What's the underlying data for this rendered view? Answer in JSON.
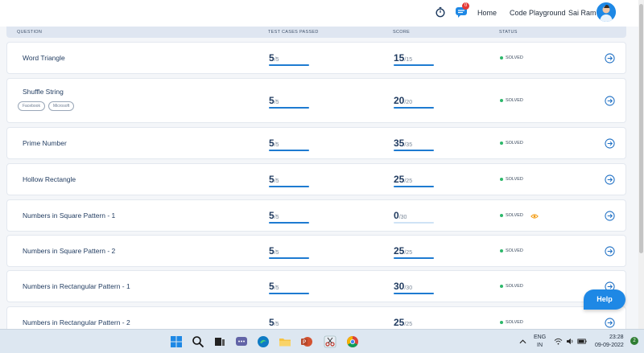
{
  "nav": {
    "home": "Home",
    "playground": "Code Playground",
    "user": "Sai Ram",
    "chat_badge": "0"
  },
  "table": {
    "headers": [
      "QUESTION",
      "TEST CASES PASSED",
      "SCORE",
      "STATUS"
    ],
    "rows": [
      {
        "name": "Word Triangle",
        "tags": [],
        "passed": "5",
        "total": "/5",
        "score": "15",
        "max": "/15",
        "status": "SOLVED",
        "viewed": false
      },
      {
        "name": "Shuffle String",
        "tags": [
          "Facebook",
          "Microsoft"
        ],
        "passed": "5",
        "total": "/5",
        "score": "20",
        "max": "/20",
        "status": "SOLVED",
        "viewed": false
      },
      {
        "name": "Prime Number",
        "tags": [],
        "passed": "5",
        "total": "/5",
        "score": "35",
        "max": "/35",
        "status": "SOLVED",
        "viewed": false
      },
      {
        "name": "Hollow Rectangle",
        "tags": [],
        "passed": "5",
        "total": "/5",
        "score": "25",
        "max": "/25",
        "status": "SOLVED",
        "viewed": false
      },
      {
        "name": "Numbers in Square Pattern - 1",
        "tags": [],
        "passed": "5",
        "total": "/5",
        "score": "0",
        "max": "/30",
        "status": "SOLVED",
        "viewed": true
      },
      {
        "name": "Numbers in Square Pattern - 2",
        "tags": [],
        "passed": "5",
        "total": "/5",
        "score": "25",
        "max": "/25",
        "status": "SOLVED",
        "viewed": false
      },
      {
        "name": "Numbers in Rectangular Pattern - 1",
        "tags": [],
        "passed": "5",
        "total": "/5",
        "score": "30",
        "max": "/30",
        "status": "SOLVED",
        "viewed": false
      },
      {
        "name": "Numbers in Rectangular Pattern - 2",
        "tags": [],
        "passed": "5",
        "total": "/5",
        "score": "25",
        "max": "/25",
        "status": "SOLVED",
        "viewed": false
      }
    ]
  },
  "help": {
    "label": "Help"
  },
  "taskbar": {
    "lang_top": "ENG",
    "lang_bottom": "IN",
    "time": "23:28",
    "date": "09-09-2022",
    "notifications": "2"
  },
  "colors": {
    "accent": "#1e88e5",
    "solved": "#2eb86b",
    "bar": "#1e7bd1",
    "eye": "#f39c12"
  }
}
